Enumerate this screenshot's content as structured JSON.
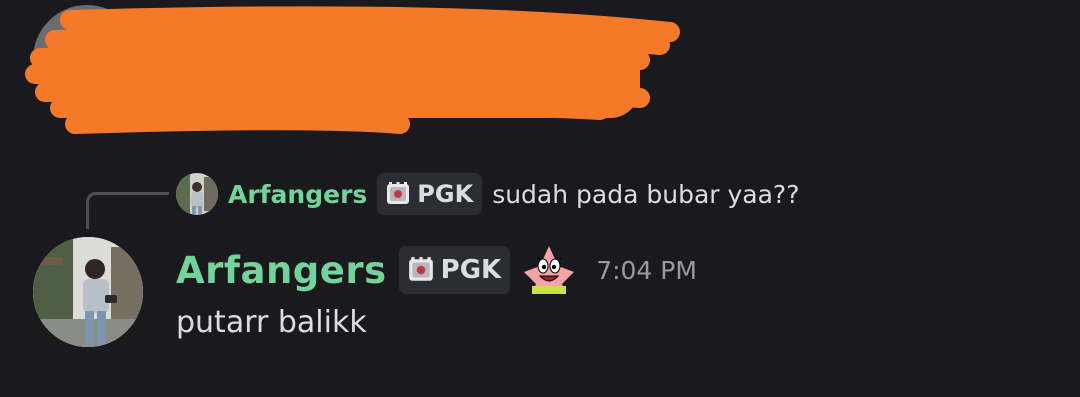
{
  "previous_message": {
    "status": "redacted"
  },
  "reply": {
    "username": "Arfangers",
    "tag": "PGK",
    "text": "sudah pada bubar yaa??"
  },
  "message": {
    "username": "Arfangers",
    "tag": "PGK",
    "emoji_icon": "patrick-star-emoji-icon",
    "timestamp": "7:04 PM",
    "text": "putarr balikk"
  },
  "colors": {
    "background": "#1a1a1e",
    "username": "#74d39b",
    "text": "#dbdee1",
    "timestamp": "#949ba4",
    "tag_bg": "#2c2d33",
    "redaction": "#f47a2a"
  }
}
